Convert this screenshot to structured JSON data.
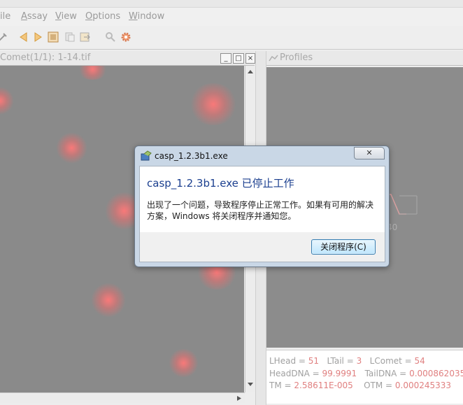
{
  "menubar": {
    "items": [
      {
        "label": "ile",
        "u": ""
      },
      {
        "label": "ssay",
        "u": "A"
      },
      {
        "label": "iew",
        "u": "V"
      },
      {
        "label": "ptions",
        "u": "O"
      },
      {
        "label": "indow",
        "u": "W"
      }
    ]
  },
  "toolbar": {
    "icons": [
      "arrow-left-icon",
      "arrow-right-icon",
      "image-icon",
      "copy-icon",
      "export-icon",
      "tools-icon",
      "settings-gear-icon"
    ]
  },
  "image_window": {
    "title": "Comet(1/1): 1-14.tif",
    "min_glyph": "_",
    "max_glyph": "□",
    "close_glyph": "×"
  },
  "profiles_panel": {
    "title": "Profiles",
    "axis_tick": "40"
  },
  "stats": {
    "lhead_label": "LHead = ",
    "lhead": "51",
    "ltail_label": "LTail = ",
    "ltail": "3",
    "lcomet_label": "LComet = ",
    "lcomet": "54",
    "headdna_label": "HeadDNA = ",
    "headdna": "99.9991",
    "taildna_label": "TailDNA = ",
    "taildna": "0.000862035",
    "tm_label": "TM = ",
    "tm": "2.58611E-005",
    "otm_label": "OTM = ",
    "otm": "0.000245333"
  },
  "dialog": {
    "title": "casp_1.2.3b1.exe",
    "close_glyph": "✕",
    "heading": "casp_1.2.3b1.exe 已停止工作",
    "message": "出现了一个问题，导致程序停止正常工作。如果有可用的解决方案，Windows 将关闭程序并通知您。",
    "button": "关闭程序(C)"
  },
  "colors": {
    "dialog_heading": "#1b3f8f",
    "stat_value": "#e08080",
    "image_bg": "#8a8a8a"
  }
}
